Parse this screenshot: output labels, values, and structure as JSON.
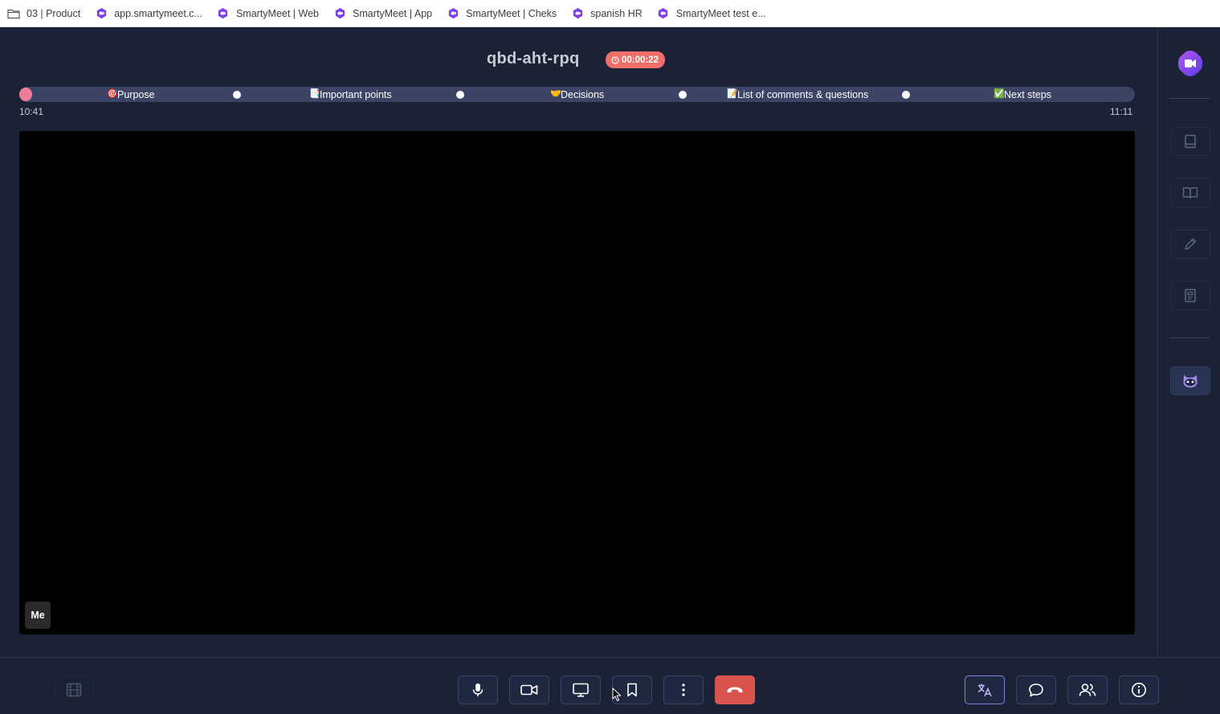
{
  "bookmarks": [
    {
      "label": "03 | Product",
      "icon": "folder-icon"
    },
    {
      "label": "app.smartymeet.c...",
      "icon": "smartymeet-icon"
    },
    {
      "label": "SmartyMeet | Web",
      "icon": "smartymeet-icon"
    },
    {
      "label": "SmartyMeet | App",
      "icon": "smartymeet-icon"
    },
    {
      "label": "SmartyMeet | Cheks",
      "icon": "smartymeet-icon"
    },
    {
      "label": "spanish HR",
      "icon": "smartymeet-icon"
    },
    {
      "label": "SmartyMeet test e...",
      "icon": "smartymeet-icon"
    }
  ],
  "meeting": {
    "title": "qbd-aht-rpq",
    "timer": "00:00:22"
  },
  "agenda": {
    "items": [
      {
        "emoji": "🎯",
        "label": "Purpose"
      },
      {
        "emoji": "📑",
        "label": "Important points"
      },
      {
        "emoji": "🤝",
        "label": "Decisions"
      },
      {
        "emoji": "📝",
        "label": "List of comments & questions"
      },
      {
        "emoji": "✅",
        "label": "Next steps"
      }
    ],
    "start_time": "10:41",
    "end_time": "11:11"
  },
  "video": {
    "self_label": "Me"
  },
  "sidebar": {
    "buttons": [
      "notes-icon",
      "book-icon",
      "pencil-icon",
      "document-icon",
      "bot-avatar-icon"
    ]
  },
  "controls": {
    "left": [
      "grid-layout-icon"
    ],
    "center": [
      "microphone-icon",
      "camera-icon",
      "screen-share-icon",
      "bookmark-icon",
      "more-options-icon",
      "end-call-icon"
    ],
    "right": [
      "translate-icon",
      "chat-icon",
      "participants-icon",
      "info-icon"
    ]
  },
  "colors": {
    "background": "#1b2235",
    "agenda_bar": "#3c4466",
    "timer_badge": "#ee6f6a",
    "end_call": "#d9534f",
    "accent": "#8b7ee0"
  }
}
